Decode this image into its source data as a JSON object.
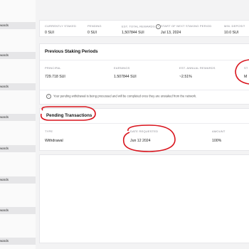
{
  "sidebar": {
    "items": [
      {
        "label": "rewards"
      },
      {
        "label": "rewards"
      },
      {
        "label": "rewards"
      },
      {
        "label": "rewards"
      },
      {
        "label": "rewards"
      },
      {
        "label": "rewards"
      },
      {
        "label": "rewards"
      },
      {
        "label": "rewards"
      }
    ]
  },
  "summary": {
    "columns": [
      {
        "label": "CURRENTLY STAKED",
        "value": "0 SUI"
      },
      {
        "label": "PENDING",
        "value": "0 SUI"
      },
      {
        "label": "EST. TOTAL REWARDS",
        "value": "1,507844 SUI"
      },
      {
        "label": "START OF NEXT STAKING PERIOD",
        "value": "Jul 13, 2024"
      },
      {
        "label": "MIN. DEPOSIT",
        "value": "10.0 SUI"
      }
    ]
  },
  "previous": {
    "title": "Previous Staking Periods",
    "headers": [
      "PRINCIPAL",
      "EARNINGS",
      "EST. ANNUAL REWARDS",
      "ST"
    ],
    "row": [
      "729.718 SUI",
      "1.507844 SUI",
      "~2.51%",
      "M"
    ]
  },
  "notice": {
    "text": "Your pending withdrawal is being processed and will be completed once they are unstaked from the network."
  },
  "pending": {
    "title": "Pending Transactions",
    "headers": [
      "TYPE",
      "DATE REQUESTED",
      "AMOUNT"
    ],
    "row": [
      "Withdrawal",
      "Jun 12 2024",
      "100%"
    ]
  },
  "colors": {
    "annotation": "#d9141d",
    "background": "#f3f3f4"
  }
}
